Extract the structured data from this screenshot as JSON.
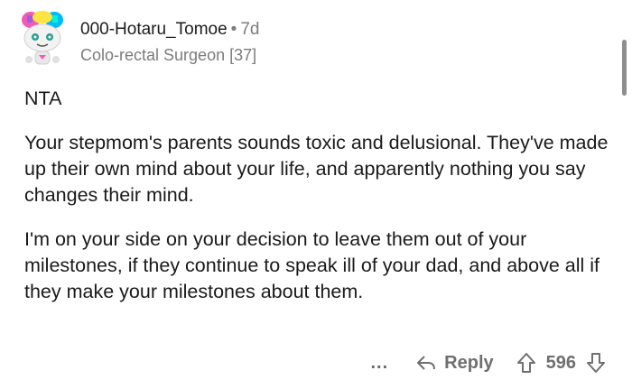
{
  "comment": {
    "username": "000-Hotaru_Tomoe",
    "separator": "•",
    "age": "7d",
    "flair": "Colo-rectal Surgeon [37]",
    "paragraphs": [
      "NTA",
      "Your stepmom's parents sounds toxic and delusional. They've made up their own mind about your life, and apparently nothing you say changes their mind.",
      "I'm on your side on your decision to leave them out of your milestones, if they continue to speak ill of your dad, and above all if they make your milestones about them."
    ]
  },
  "actions": {
    "more_label": "...",
    "reply_label": "Reply",
    "score": "596"
  },
  "icons": {
    "reply": "reply-arrow-icon",
    "upvote": "upvote-arrow-icon",
    "downvote": "downvote-arrow-icon",
    "avatar": "snoo-avatar"
  }
}
